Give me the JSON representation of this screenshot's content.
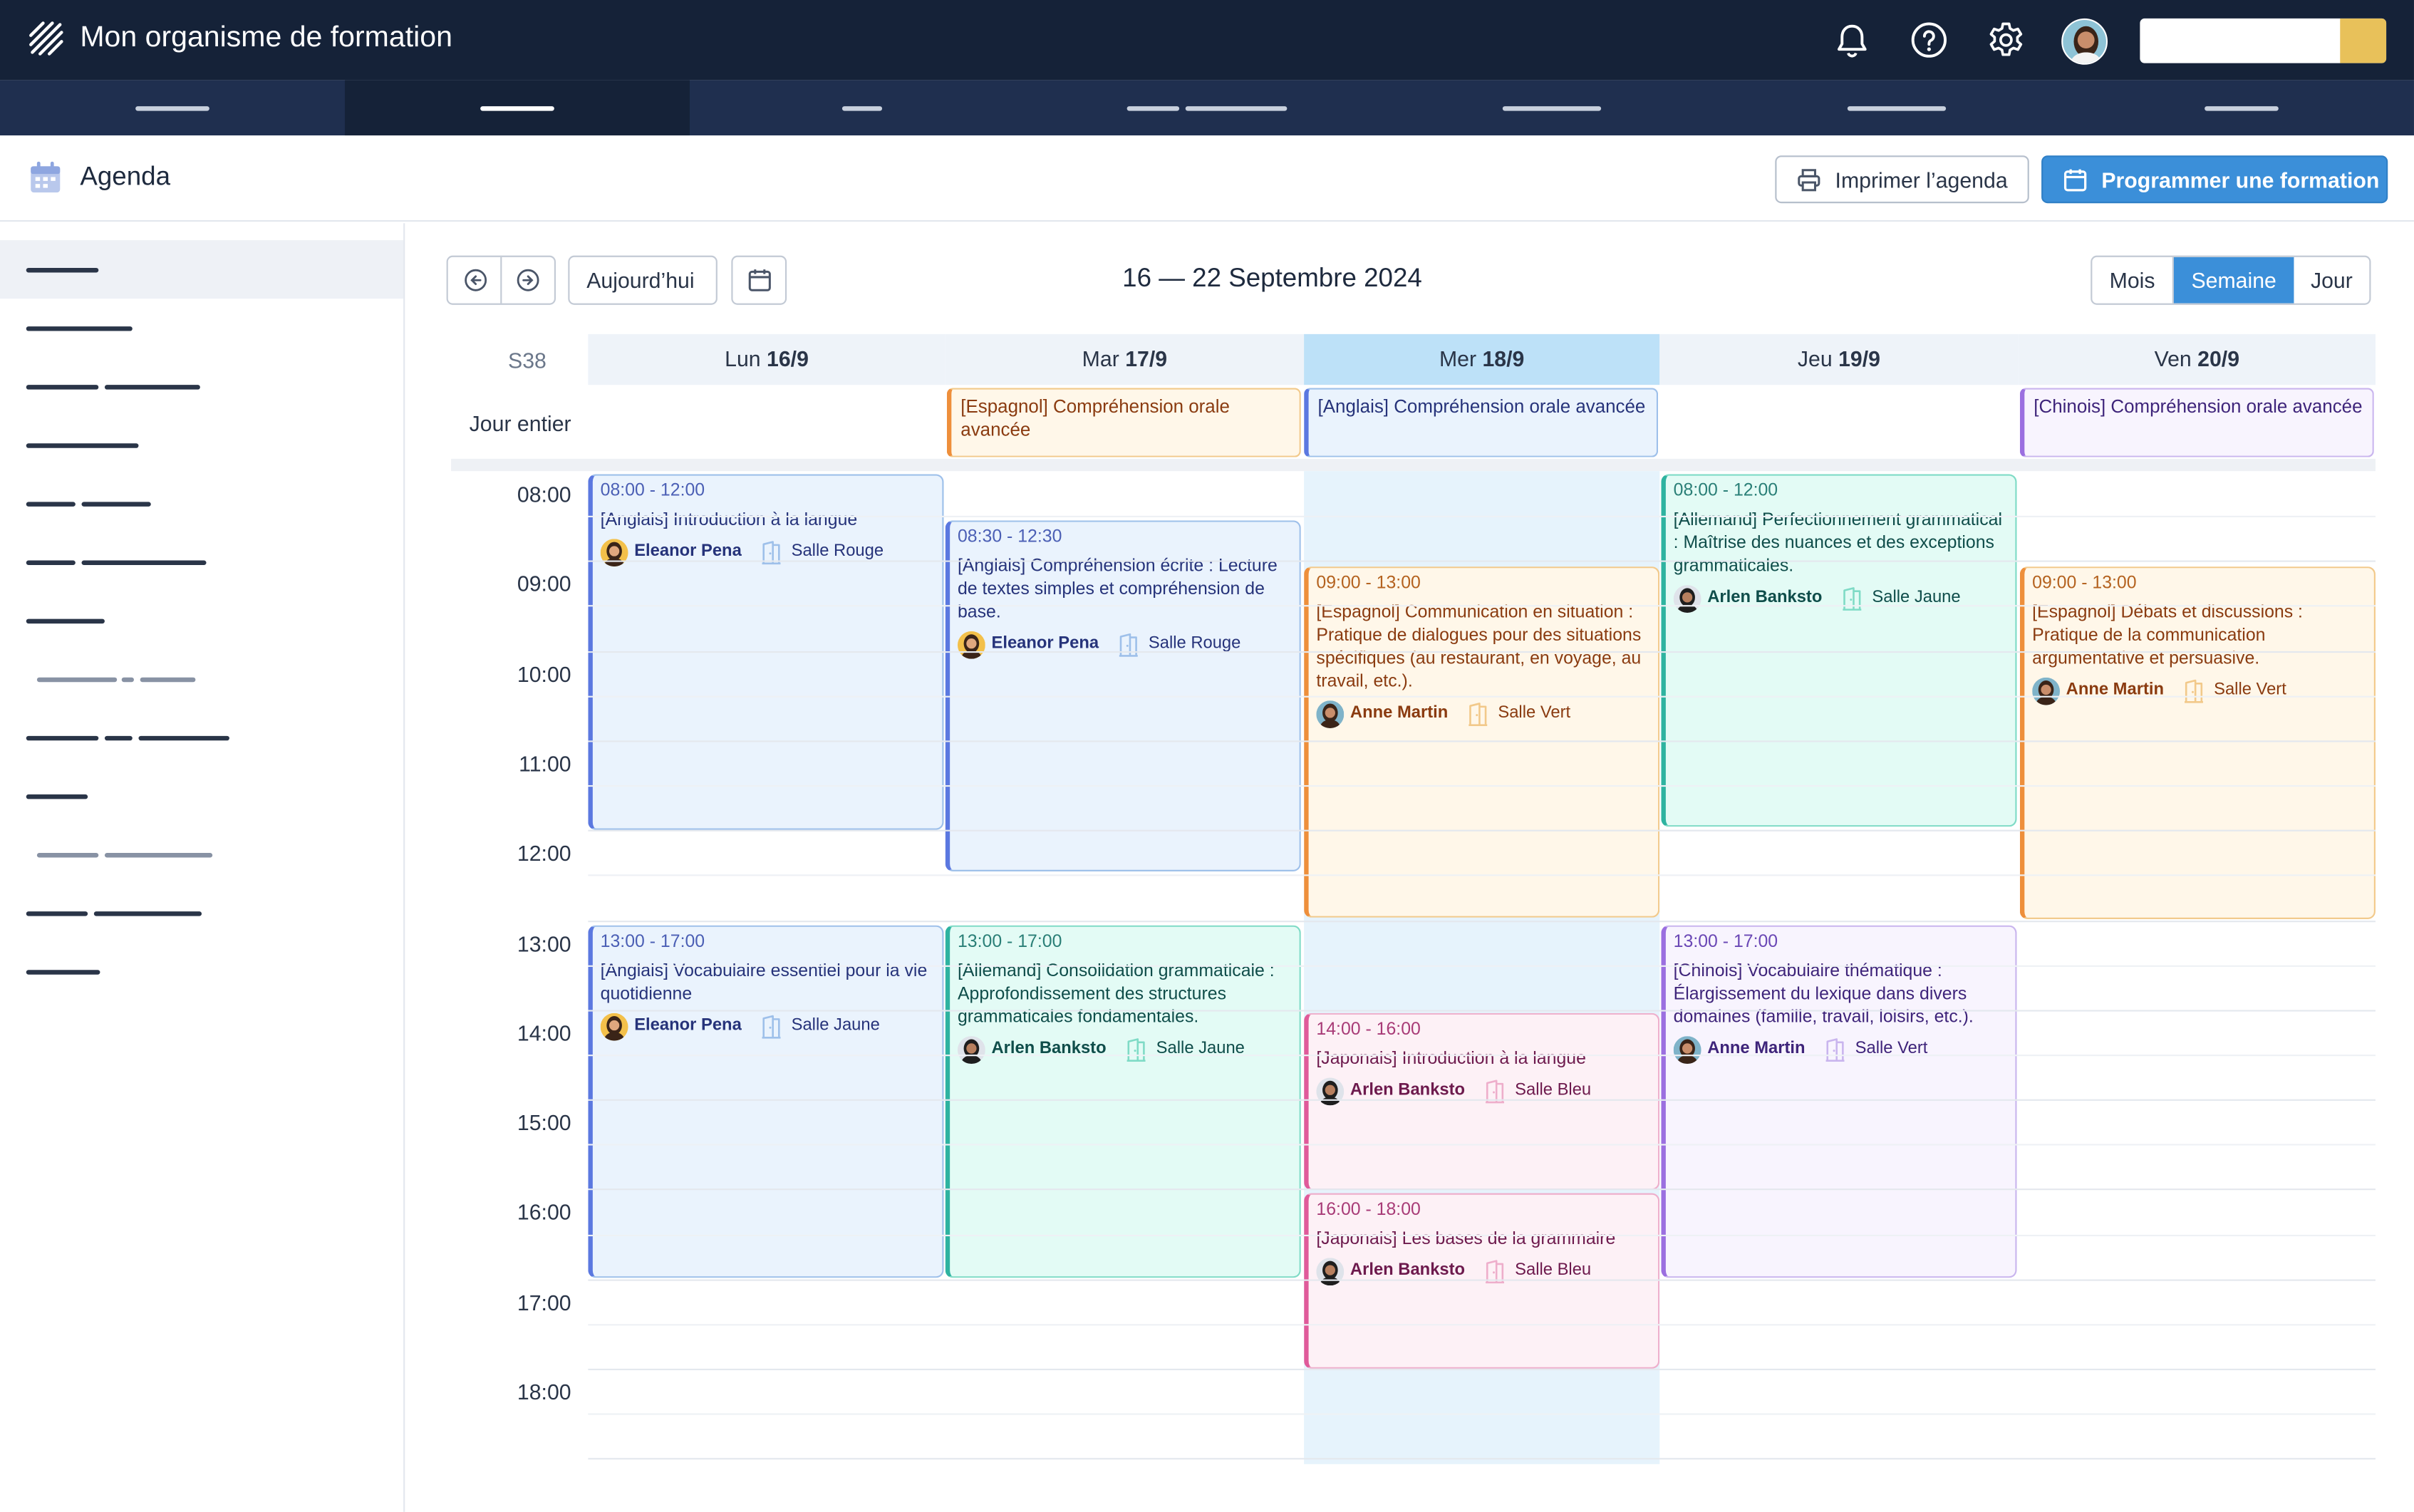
{
  "app": {
    "title": "Mon organisme de formation"
  },
  "topbar": {
    "icons": [
      "bell-icon",
      "help-icon",
      "gear-icon",
      "user-avatar"
    ],
    "search_value": ""
  },
  "page": {
    "title": "Agenda",
    "print_label": "Imprimer l’agenda",
    "schedule_label": "Programmer une formation"
  },
  "toolbar": {
    "today_label": "Aujourd’hui",
    "range": "16 — 22 Septembre 2024",
    "views": [
      "Mois",
      "Semaine",
      "Jour"
    ],
    "active_view": "Semaine"
  },
  "calendar": {
    "week_label": "S38",
    "allday_label": "Jour entier",
    "days": [
      {
        "dow": "Lun",
        "date": "16/9"
      },
      {
        "dow": "Mar",
        "date": "17/9"
      },
      {
        "dow": "Mer",
        "date": "18/9"
      },
      {
        "dow": "Jeu",
        "date": "19/9"
      },
      {
        "dow": "Ven",
        "date": "20/9"
      }
    ],
    "today_index": 2,
    "hours": [
      "08:00",
      "09:00",
      "10:00",
      "11:00",
      "12:00",
      "13:00",
      "14:00",
      "15:00",
      "16:00",
      "17:00",
      "18:00"
    ],
    "allday_events": [
      {
        "title": "[Espagnol] Compréhension orale avancée",
        "color": "orange"
      },
      {
        "title": "[Anglais] Compréhension orale avancée",
        "color": "blue"
      },
      {
        "title": "[Chinois] Compréhension orale avancée",
        "color": "purple"
      }
    ],
    "events": [
      {
        "time": "08:00 - 12:00",
        "title": "[Anglais] Introduction à la langue",
        "trainer": "Eleanor Pena",
        "room": "Salle Rouge",
        "color": "blue"
      },
      {
        "time": "08:30 - 12:30",
        "title": "[Anglais] Compréhension écrite : Lecture de textes simples et compréhension de base.",
        "trainer": "Eleanor Pena",
        "room": "Salle Rouge",
        "color": "blue"
      },
      {
        "time": "09:00 - 13:00",
        "title": "[Espagnol] Communication en situation : Pratique de dialogues pour des situations spécifiques (au restaurant, en voyage, au travail, etc.).",
        "trainer": "Anne Martin",
        "room": "Salle Vert",
        "color": "orange"
      },
      {
        "time": "08:00 - 12:00",
        "title": "[Allemand] Perfectionnement grammatical : Maîtrise des nuances et des exceptions grammaticales.",
        "trainer": "Arlen Banksto",
        "room": "Salle Jaune",
        "color": "teal"
      },
      {
        "time": "09:00 - 13:00",
        "title": "[Espagnol] Débats et discussions : Pratique de la communication argumentative et persuasive.",
        "trainer": "Anne Martin",
        "room": "Salle Vert",
        "color": "orange"
      },
      {
        "time": "13:00 - 17:00",
        "title": "[Anglais] Vocabulaire essentiel pour la vie quotidienne",
        "trainer": "Eleanor Pena",
        "room": "Salle Jaune",
        "color": "blue"
      },
      {
        "time": "13:00 - 17:00",
        "title": "[Allemand] Consolidation grammaticale : Approfondissement des structures grammaticales fondamentales.",
        "trainer": "Arlen Banksto",
        "room": "Salle Jaune",
        "color": "teal"
      },
      {
        "time": "14:00 - 16:00",
        "title": "[Japonais] Introduction à la langue",
        "trainer": "Arlen Banksto",
        "room": "Salle Bleu",
        "color": "pink"
      },
      {
        "time": "16:00 - 18:00",
        "title": "[Japonais] Les bases de la grammaire",
        "trainer": "Arlen Banksto",
        "room": "Salle Bleu",
        "color": "pink"
      },
      {
        "time": "13:00 - 17:00",
        "title": "[Chinois] Vocabulaire thématique : Élargissement du lexique dans divers domaines (famille, travail, loisirs, etc.).",
        "trainer": "Anne Martin",
        "room": "Salle Vert",
        "color": "purple"
      }
    ]
  }
}
